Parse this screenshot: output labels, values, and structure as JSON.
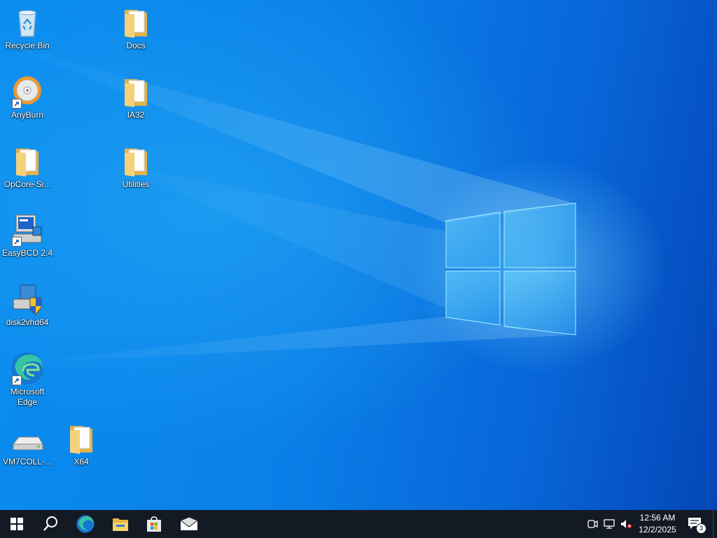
{
  "desktop": {
    "icons": [
      {
        "label": "Recycle Bin",
        "icon": "recycle-bin-icon"
      },
      {
        "label": "AnyBurn",
        "icon": "disc-icon"
      },
      {
        "label": "OpCore-Si...",
        "icon": "folder-icon"
      },
      {
        "label": "EasyBCD 2.4",
        "icon": "computer-icon"
      },
      {
        "label": "disk2vhd64",
        "icon": "disk-shield-icon"
      },
      {
        "label": "Microsoft Edge",
        "icon": "edge-icon"
      },
      {
        "label": "VM7COLL-...",
        "icon": "drive-icon"
      },
      {
        "label": "Docs",
        "icon": "folder-icon"
      },
      {
        "label": "IA32",
        "icon": "folder-icon"
      },
      {
        "label": "Utilities",
        "icon": "folder-icon"
      },
      {
        "label": "X64",
        "icon": "folder-icon"
      }
    ]
  },
  "taskbar": {
    "start": "windows-logo-icon",
    "pinned": [
      "search-icon",
      "edge-icon",
      "file-explorer-icon",
      "store-icon",
      "mail-icon"
    ],
    "tray": [
      "meet-now-icon",
      "network-icon",
      "volume-muted-icon"
    ],
    "clock": {
      "time": "12:56 AM",
      "date": "12/2/2025"
    },
    "notifications": {
      "count": "3"
    }
  },
  "colors": {
    "taskbar": "#141a24",
    "accent": "#0a7fe8"
  }
}
